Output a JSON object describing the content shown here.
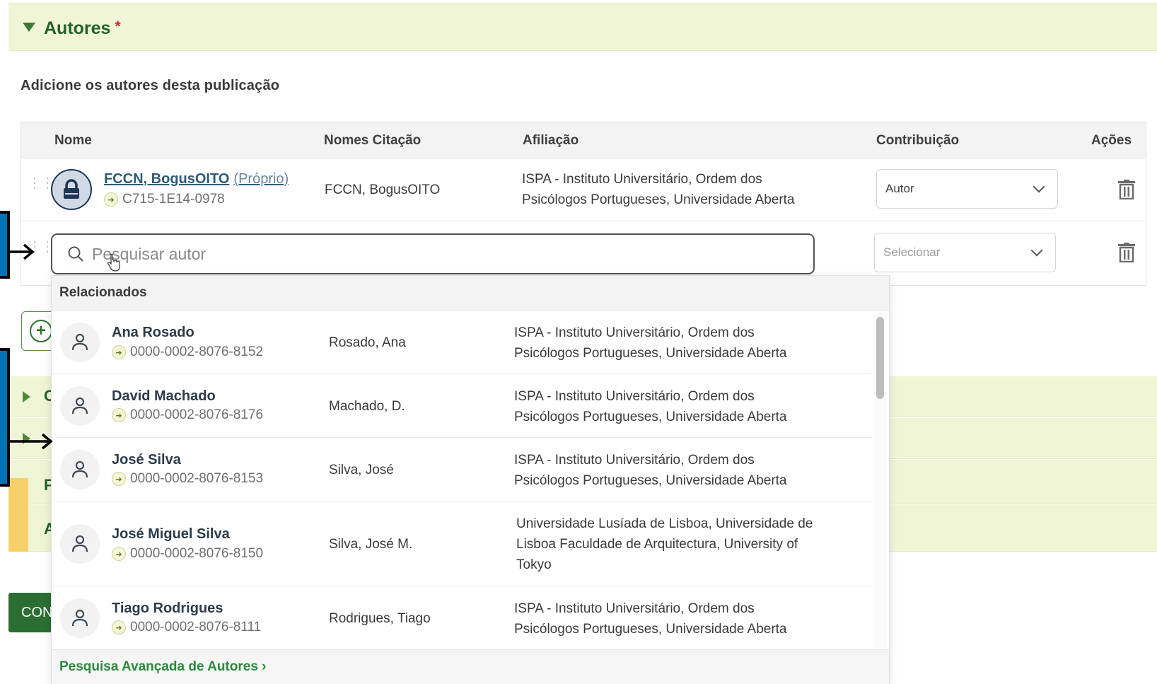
{
  "section": {
    "title": "Autores",
    "required_marker": "*",
    "intro": "Adicione os autores desta publicação"
  },
  "table": {
    "headers": {
      "name": "Nome",
      "citation": "Nomes Citação",
      "affiliation": "Afiliação",
      "contribution": "Contribuição",
      "actions": "Ações"
    },
    "row1": {
      "name": "FCCN, BogusOITO",
      "own": "(Próprio)",
      "id": "C715-1E14-0978",
      "citation": "FCCN, BogusOITO",
      "affiliation_l1": "ISPA - Instituto Universitário, Ordem dos",
      "affiliation_l2": "Psicólogos Portugueses, Universidade Aberta",
      "contribution": "Autor"
    },
    "row2": {
      "search_placeholder": "Pesquisar autor",
      "contribution_placeholder": "Selecionar"
    }
  },
  "dropdown": {
    "header": "Relacionados",
    "items": [
      {
        "name": "Ana Rosado",
        "orcid": "0000-0002-8076-8152",
        "citation": "Rosado, Ana",
        "aff1": "ISPA - Instituto Universitário, Ordem dos",
        "aff2": "Psicólogos Portugueses, Universidade Aberta"
      },
      {
        "name": "David Machado",
        "orcid": "0000-0002-8076-8176",
        "citation": "Machado, D.",
        "aff1": "ISPA - Instituto Universitário, Ordem dos",
        "aff2": "Psicólogos Portugueses, Universidade Aberta"
      },
      {
        "name": "José Silva",
        "orcid": "0000-0002-8076-8153",
        "citation": "Silva, José",
        "aff1": "ISPA - Instituto Universitário, Ordem dos",
        "aff2": "Psicólogos Portugueses, Universidade Aberta"
      },
      {
        "name": "José Miguel Silva",
        "orcid": "0000-0002-8076-8150",
        "citation": "Silva, José M.",
        "aff1": "Universidade Lusíada de Lisboa, Universidade de",
        "aff2": "Lisboa Faculdade de Arquitectura, University of",
        "aff3": "Tokyo"
      },
      {
        "name": "Tiago Rodrigues",
        "orcid": "0000-0002-8076-8111",
        "citation": "Rodrigues, Tiago",
        "aff1": "ISPA - Instituto Universitário, Ordem dos",
        "aff2": "Psicólogos Portugueses, Universidade Aberta"
      }
    ],
    "footer_link": "Pesquisa Avançada de Autores ›"
  },
  "background": {
    "collapsed_letters": [
      "C",
      "",
      "F",
      "A"
    ],
    "button_partial": "CON"
  },
  "colors": {
    "accent_green": "#23622b",
    "section_bg": "#f0f5d7",
    "annotation_blue": "#0073b7"
  }
}
